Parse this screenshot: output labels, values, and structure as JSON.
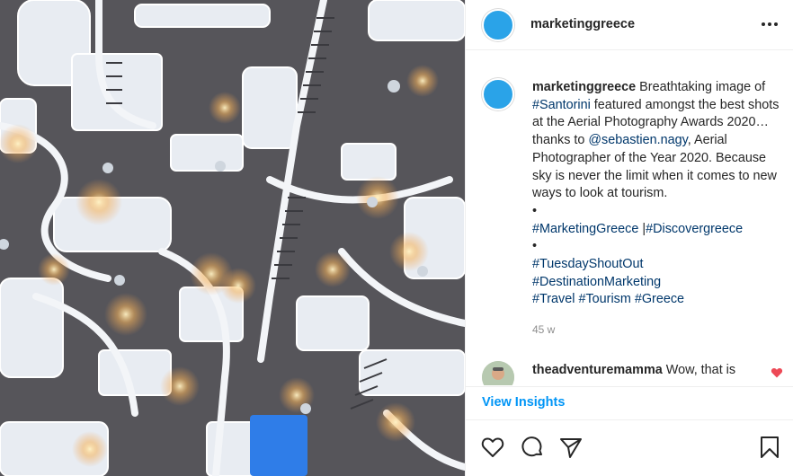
{
  "post": {
    "image": {
      "description_icon": "aerial-photo"
    },
    "header": {
      "username": "marketinggreece",
      "more_icon": "more-options-icon"
    },
    "caption": {
      "username": "marketinggreece",
      "t1": " Breathtaking image of ",
      "tag_santorini": "#Santorini",
      "t2": " featured amongst the best shots at the Aerial Photography Awards 2020… thanks to ",
      "mention": "@sebastien.nagy",
      "t3": ", Aerial Photographer of the Year 2020. Because sky is never the limit when it comes to new ways to look at tourism.",
      "bullet": "•",
      "tag_mg": "#MarketingGreece",
      "sep": " |",
      "tag_dg": "#Discovergreece",
      "tag_tso": "#TuesdayShoutOut",
      "tag_dm": "#DestinationMarketing",
      "tag_travel": "#Travel",
      "tag_tourism": "#Tourism",
      "tag_greece": "#Greece",
      "age": "45 w"
    },
    "comment": {
      "username": "theadventuremamma",
      "text": " Wow, that is"
    },
    "insights_label": "View Insights",
    "colors": {
      "accent": "#0095f6",
      "link": "#00376b",
      "like": "#ed4956",
      "avatar": "#2aa3e8"
    }
  }
}
